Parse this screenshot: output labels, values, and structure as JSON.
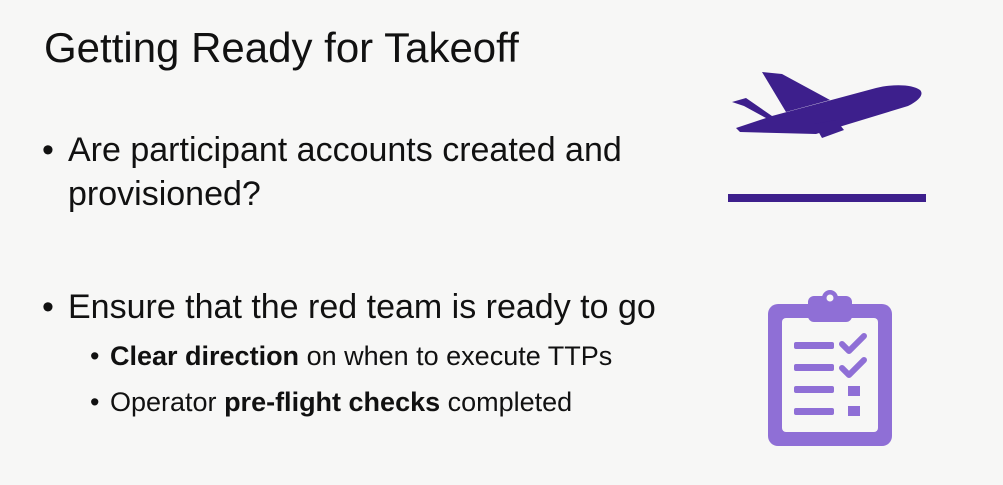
{
  "slide": {
    "title": "Getting Ready for Takeoff",
    "bullets": [
      {
        "dot": "•",
        "line1": "Are participant accounts created and",
        "line2": "provisioned?"
      },
      {
        "dot": "•",
        "text": "Ensure that the red team is ready to go",
        "sub": [
          {
            "dot": "•",
            "bold": "Clear direction",
            "rest": " on when to execute TTPs"
          },
          {
            "dot": "•",
            "pre": "Operator ",
            "bold": "pre-flight checks",
            "rest": " completed"
          }
        ]
      }
    ]
  },
  "icons": {
    "plane": "airplane-takeoff-icon",
    "clipboard": "clipboard-checklist-icon"
  },
  "colors": {
    "plane": "#3d1f8c",
    "clipboard": "#8f6fd6",
    "text": "#111111",
    "background": "#f7f7f6"
  }
}
